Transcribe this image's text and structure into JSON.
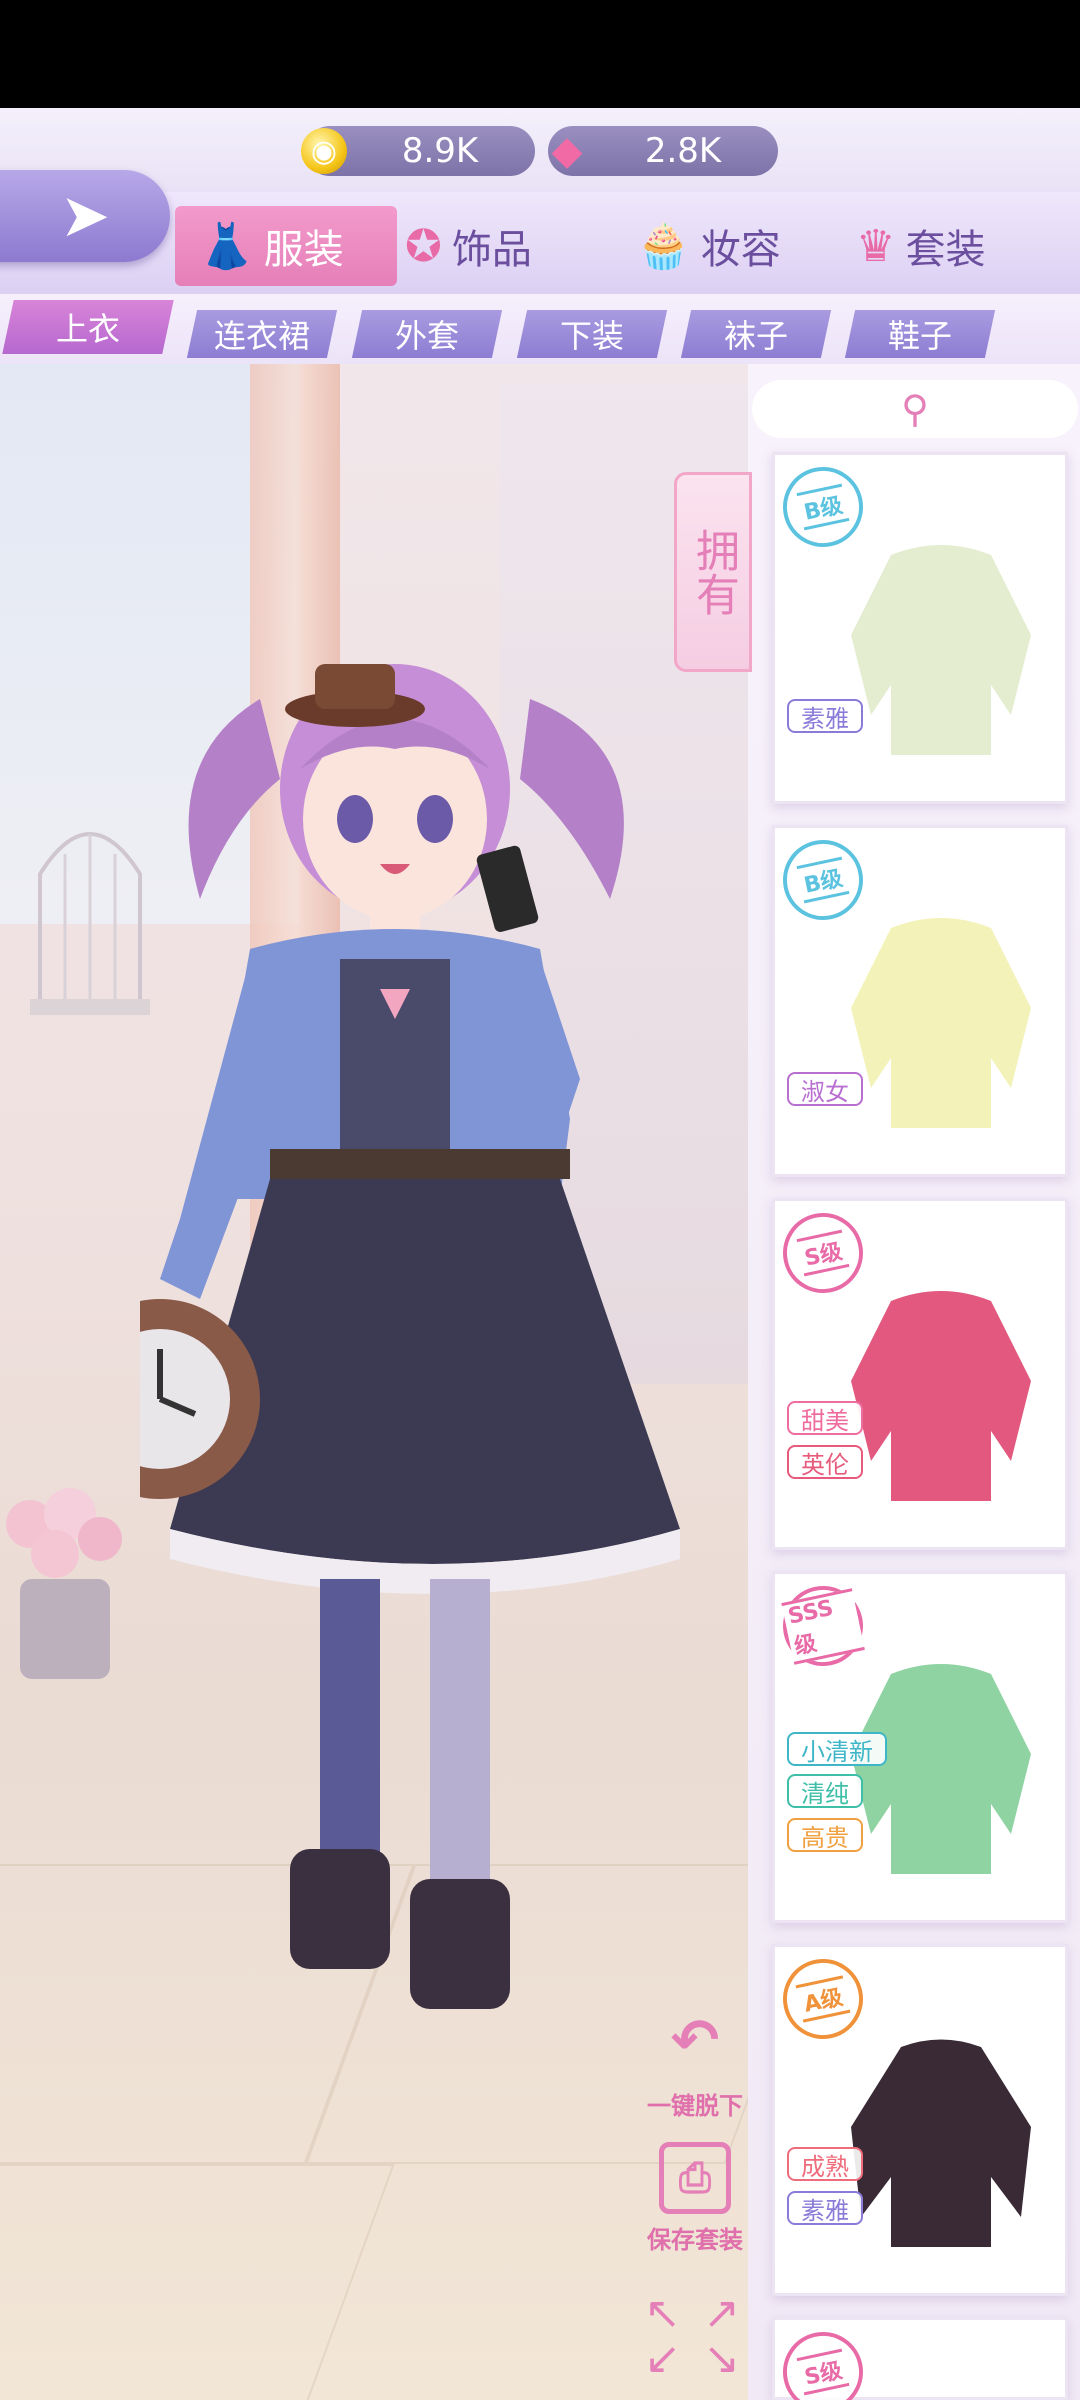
{
  "currency": {
    "coins": "8.9K",
    "gems": "2.8K"
  },
  "categories": [
    {
      "label": "服装",
      "icon": "dress-icon"
    },
    {
      "label": "饰品",
      "icon": "star-glasses-icon"
    },
    {
      "label": "妆容",
      "icon": "cake-icon"
    },
    {
      "label": "套装",
      "icon": "crown-icon"
    }
  ],
  "subcategories": [
    "上衣",
    "连衣裙",
    "外套",
    "下装",
    "袜子",
    "鞋子"
  ],
  "side": {
    "owned_label": "拥有",
    "search_icon": "search-icon"
  },
  "items": [
    {
      "grade": "B级",
      "grade_color": "#5bc3e0",
      "garment_color": "#e4edcf",
      "tags": [
        {
          "text": "素雅",
          "color": "#8b7bd8"
        }
      ]
    },
    {
      "grade": "B级",
      "grade_color": "#5bc3e0",
      "garment_color": "#f3f2b8",
      "tags": [
        {
          "text": "淑女",
          "color": "#b86fd0"
        }
      ]
    },
    {
      "grade": "S级",
      "grade_color": "#e86aa6",
      "garment_color": "#e2587f",
      "tags": [
        {
          "text": "甜美",
          "color": "#ef6c9e"
        },
        {
          "text": "英伦",
          "color": "#e85a7c"
        }
      ]
    },
    {
      "grade": "SSS级",
      "grade_color": "#e86aa6",
      "garment_color": "#8fd3a2",
      "tags": [
        {
          "text": "小清新",
          "color": "#3fb6c8"
        },
        {
          "text": "清纯",
          "color": "#3fbfa8"
        },
        {
          "text": "高贵",
          "color": "#f0a040"
        }
      ]
    },
    {
      "grade": "A级",
      "grade_color": "#f0923a",
      "garment_color": "#3a2a35",
      "tags": [
        {
          "text": "成熟",
          "color": "#ef6c7c"
        },
        {
          "text": "素雅",
          "color": "#8b7bd8"
        }
      ]
    },
    {
      "grade": "S级",
      "grade_color": "#e86aa6",
      "garment_color": "#e2587f",
      "tags": []
    }
  ],
  "actions": {
    "undress_label": "一键脱下",
    "save_label": "保存套装"
  }
}
